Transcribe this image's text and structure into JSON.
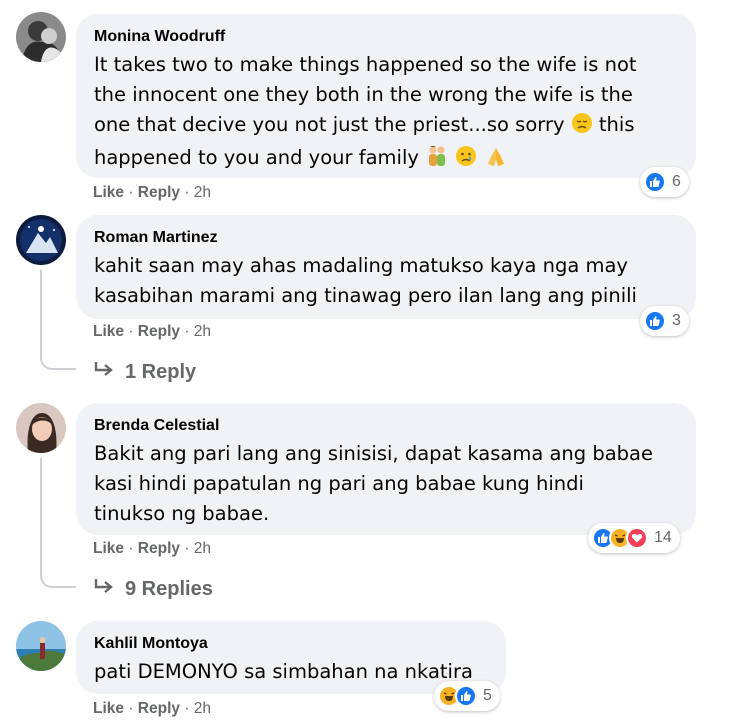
{
  "actions": {
    "like": "Like",
    "reply": "Reply",
    "sep": " · "
  },
  "comments": [
    {
      "author": "Monina Woodruff",
      "lines": [
        "It takes two to make things happened so the wife is not",
        "the innocent one they both in the wrong the wife is the",
        "one that decive you not just the priest...so sorry ",
        "happened to you and your family "
      ],
      "line3_tail": " this",
      "time": "2h",
      "reaction_count": "6",
      "reactions": [
        "like-icon"
      ]
    },
    {
      "author": "Roman Martinez",
      "lines": [
        "kahit saan may ahas madaling matukso kaya nga may",
        "kasabihan marami ang tinawag pero ilan lang ang pinili"
      ],
      "time": "2h",
      "reaction_count": "3",
      "reactions": [
        "like-icon"
      ],
      "replies_label": "1 Reply"
    },
    {
      "author": "Brenda Celestial",
      "lines": [
        "Bakit ang pari lang ang sinisisi, dapat kasama ang babae",
        "kasi hindi papatulan ng pari ang babae kung hindi",
        "tinukso ng babae."
      ],
      "time": "2h",
      "reaction_count": "14",
      "reactions": [
        "like-icon",
        "haha-icon",
        "love-icon"
      ],
      "replies_label": "9 Replies"
    },
    {
      "author": "Kahlil Montoya",
      "lines": [
        "pati DEMONYO sa simbahan na nkatira"
      ],
      "time": "2h",
      "reaction_count": "5",
      "reactions": [
        "haha-icon",
        "like-icon"
      ]
    }
  ],
  "colors": {
    "like": "#1877f2",
    "love": "#f33e58",
    "haha": "#f7b125",
    "meta": "#65676b",
    "bubble": "#f0f2f5"
  }
}
